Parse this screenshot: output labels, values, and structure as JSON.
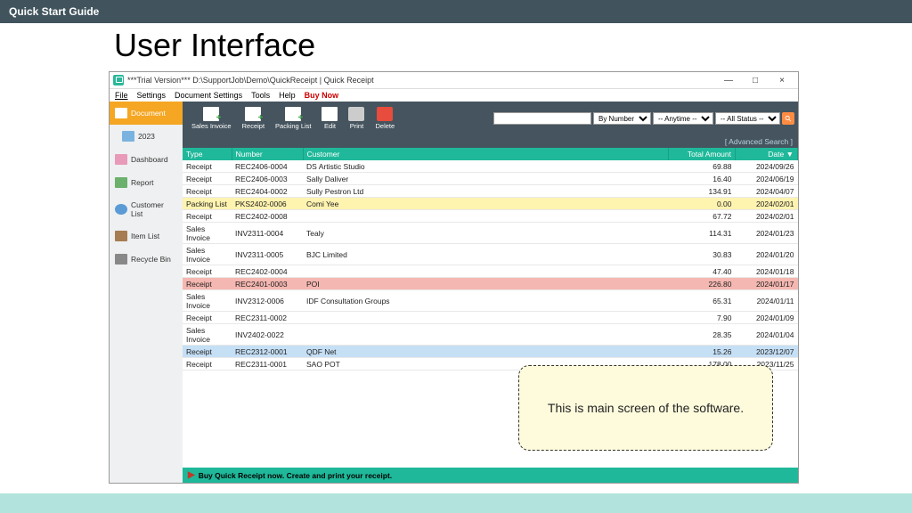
{
  "page": {
    "header": "Quick Start Guide",
    "title": "User Interface"
  },
  "window": {
    "title": "***Trial Version*** D:\\SupportJob\\Demo\\QuickReceipt | Quick Receipt",
    "controls": {
      "min": "—",
      "max": "□",
      "close": "×"
    }
  },
  "menu": {
    "file": "File",
    "settings": "Settings",
    "docset": "Document Settings",
    "tools": "Tools",
    "help": "Help",
    "buy": "Buy Now"
  },
  "sidebar": {
    "document": "Document",
    "year": "2023",
    "dashboard": "Dashboard",
    "report": "Report",
    "customer": "Customer List",
    "item": "Item List",
    "recycle": "Recycle Bin"
  },
  "toolbar": {
    "salesinv": "Sales Invoice",
    "receipt": "Receipt",
    "packing": "Packing List",
    "edit": "Edit",
    "print": "Print",
    "delete": "Delete"
  },
  "filters": {
    "bynumber": "By Number",
    "anytime": "-- Anytime --",
    "allstatus": "-- All Status --"
  },
  "advsearch": "[ Advanced Search ]",
  "cols": {
    "type": "Type",
    "number": "Number",
    "customer": "Customer",
    "amount": "Total Amount",
    "date": "Date ▼"
  },
  "rows": [
    {
      "type": "Receipt",
      "num": "REC2406-0004",
      "cust": "DS Artistic Studio",
      "amt": "69.88",
      "date": "2024/09/26",
      "hl": ""
    },
    {
      "type": "Receipt",
      "num": "REC2406-0003",
      "cust": "Sally Daliver",
      "amt": "16.40",
      "date": "2024/06/19",
      "hl": ""
    },
    {
      "type": "Receipt",
      "num": "REC2404-0002",
      "cust": "Sully Pestron Ltd",
      "amt": "134.91",
      "date": "2024/04/07",
      "hl": ""
    },
    {
      "type": "Packing List",
      "num": "PKS2402-0006",
      "cust": "Comi Yee",
      "amt": "0.00",
      "date": "2024/02/01",
      "hl": "yellow"
    },
    {
      "type": "Receipt",
      "num": "REC2402-0008",
      "cust": "",
      "amt": "67.72",
      "date": "2024/02/01",
      "hl": ""
    },
    {
      "type": "Sales Invoice",
      "num": "INV2311-0004",
      "cust": "Tealy",
      "amt": "114.31",
      "date": "2024/01/23",
      "hl": ""
    },
    {
      "type": "Sales Invoice",
      "num": "INV2311-0005",
      "cust": "BJC Limited",
      "amt": "30.83",
      "date": "2024/01/20",
      "hl": ""
    },
    {
      "type": "Receipt",
      "num": "REC2402-0004",
      "cust": "",
      "amt": "47.40",
      "date": "2024/01/18",
      "hl": ""
    },
    {
      "type": "Receipt",
      "num": "REC2401-0003",
      "cust": "POI",
      "amt": "226.80",
      "date": "2024/01/17",
      "hl": "red"
    },
    {
      "type": "Sales Invoice",
      "num": "INV2312-0006",
      "cust": "IDF Consultation Groups",
      "amt": "65.31",
      "date": "2024/01/11",
      "hl": ""
    },
    {
      "type": "Receipt",
      "num": "REC2311-0002",
      "cust": "",
      "amt": "7.90",
      "date": "2024/01/09",
      "hl": ""
    },
    {
      "type": "Sales Invoice",
      "num": "INV2402-0022",
      "cust": "",
      "amt": "28.35",
      "date": "2024/01/04",
      "hl": ""
    },
    {
      "type": "Receipt",
      "num": "REC2312-0001",
      "cust": "QDF Net",
      "amt": "15.26",
      "date": "2023/12/07",
      "hl": "blue"
    },
    {
      "type": "Receipt",
      "num": "REC2311-0001",
      "cust": "SAO POT",
      "amt": "178.00",
      "date": "2023/11/25",
      "hl": ""
    }
  ],
  "footer": "Buy Quick Receipt now. Create and print your receipt.",
  "callout": "This is main screen of the software."
}
